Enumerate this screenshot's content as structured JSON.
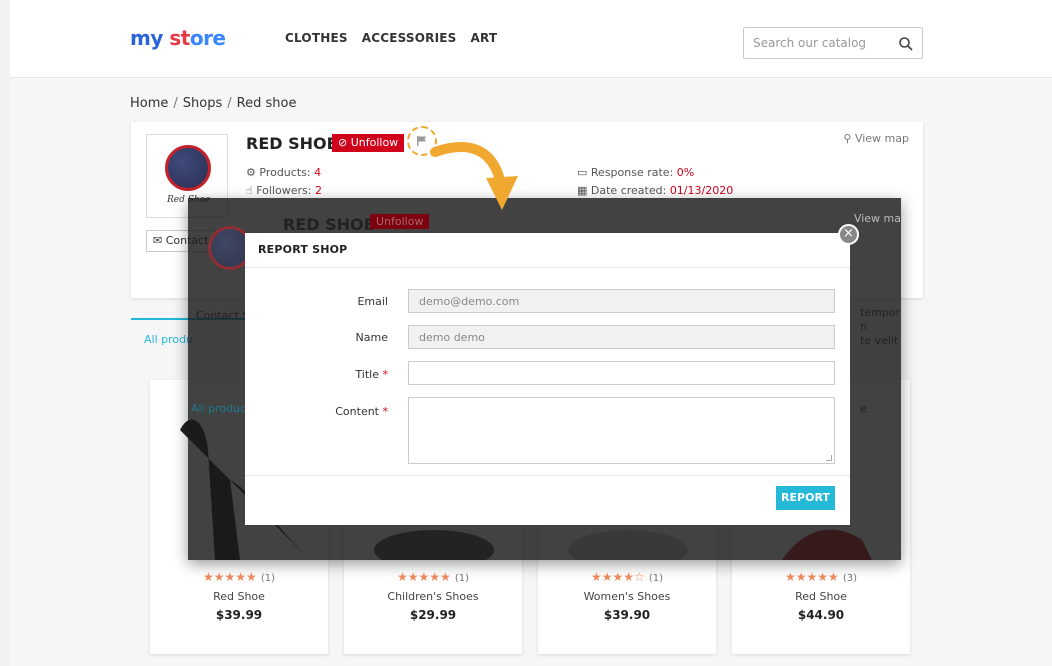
{
  "header": {
    "logo": {
      "part1": "my",
      "part2": "st",
      "part3": "ore"
    },
    "nav": [
      "CLOTHES",
      "ACCESSORIES",
      "ART"
    ],
    "search_placeholder": "Search our catalog"
  },
  "breadcrumb": [
    "Home",
    "Shops",
    "Red shoe"
  ],
  "shop": {
    "logo_text": "Red Shoe",
    "name": "RED SHOE",
    "unfollow_label": "Unfollow",
    "products_label": "Products:",
    "products_value": "4",
    "followers_label": "Followers:",
    "followers_value": "2",
    "response_label": "Response rate:",
    "response_value": "0%",
    "date_label": "Date created:",
    "date_value": "01/13/2020",
    "view_map": "View map",
    "contact_label": "Contact"
  },
  "tabs": {
    "all_products": "All produ"
  },
  "overlay_bg": {
    "shop_name": "RED SHOE",
    "unfollow": "Unfollow",
    "view_map": "View ma",
    "contact": "Contact S",
    "all_products": "All products (",
    "side_text": [
      "tempora",
      "n",
      "te velit"
    ],
    "side_e": "e"
  },
  "modal": {
    "title": "REPORT SHOP",
    "fields": {
      "email_label": "Email",
      "email_value": "demo@demo.com",
      "name_label": "Name",
      "name_value": "demo demo",
      "title_label": "Title",
      "content_label": "Content",
      "required_mark": "*"
    },
    "submit_label": "REPORT"
  },
  "products": [
    {
      "stars": "★★★★★",
      "count": "(1)",
      "name": "Red Shoe",
      "price": "$39.99"
    },
    {
      "stars": "★★★★★",
      "count": "(1)",
      "name": "Children's Shoes",
      "price": "$29.99"
    },
    {
      "stars": "★★★★☆",
      "count": "(1)",
      "name": "Women's Shoes",
      "price": "$39.90"
    },
    {
      "stars": "★★★★★",
      "count": "(3)",
      "name": "Red Shoe",
      "price": "$44.90"
    }
  ],
  "colors": {
    "accent": "#24b9d7",
    "danger": "#d0021b",
    "star": "#f08a5d",
    "highlight": "#f0a830"
  }
}
